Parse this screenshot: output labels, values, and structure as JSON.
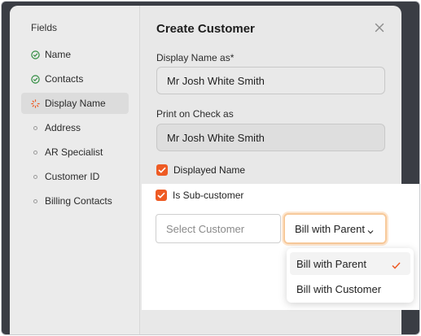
{
  "sidebar": {
    "title": "Fields",
    "items": [
      {
        "label": "Name",
        "state": "done",
        "icon": "check-circle-icon"
      },
      {
        "label": "Contacts",
        "state": "done",
        "icon": "check-circle-icon"
      },
      {
        "label": "Display Name",
        "state": "in-progress",
        "icon": "spinner-icon"
      },
      {
        "label": "Address",
        "state": "pending",
        "icon": "dot-icon"
      },
      {
        "label": "AR Specialist",
        "state": "pending",
        "icon": "dot-icon"
      },
      {
        "label": "Customer ID",
        "state": "pending",
        "icon": "dot-icon"
      },
      {
        "label": "Billing Contacts",
        "state": "pending",
        "icon": "dot-icon"
      }
    ]
  },
  "modal": {
    "title": "Create Customer",
    "display_name_label": "Display Name as*",
    "display_name_value": "Mr Josh White Smith",
    "print_check_label": "Print on Check as",
    "print_check_value": "Mr Josh White Smith",
    "displayed_name_checkbox": {
      "label": "Displayed Name",
      "checked": true
    },
    "sub_customer_checkbox": {
      "label": "Is Sub-customer",
      "checked": true
    },
    "select_customer_placeholder": "Select Customer",
    "bill_select_value": "Bill with Parent",
    "bill_options": [
      {
        "label": "Bill with Parent",
        "selected": true
      },
      {
        "label": "Bill with Customer",
        "selected": false
      }
    ]
  },
  "colors": {
    "accent": "#ee5b24",
    "success": "#2e8b3e",
    "focus_ring": "#f7c99a",
    "backdrop": "#3a3d44"
  }
}
